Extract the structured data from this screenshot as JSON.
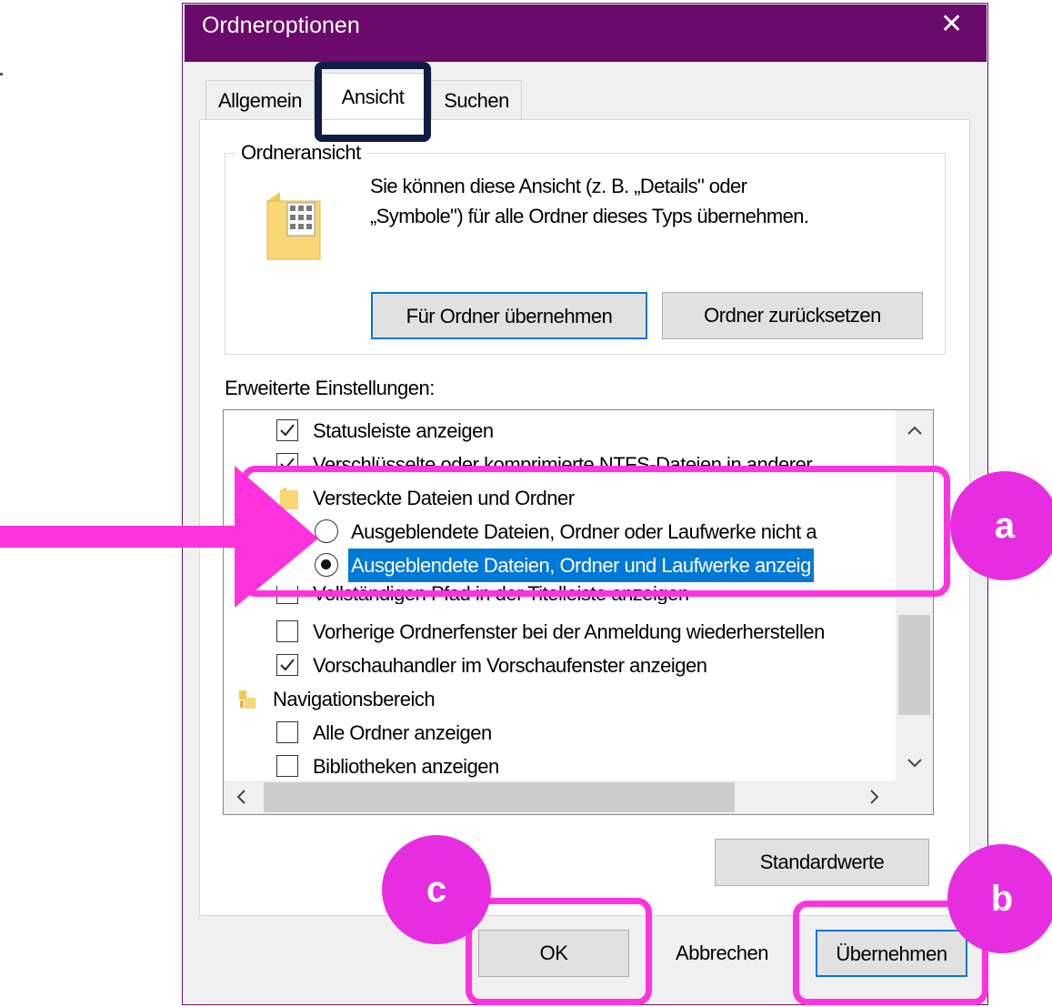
{
  "window": {
    "title": "Ordneroptionen",
    "close_glyph": "✕"
  },
  "tabs": [
    {
      "label": "Allgemein",
      "active": false
    },
    {
      "label": "Ansicht",
      "active": true
    },
    {
      "label": "Suchen",
      "active": false
    }
  ],
  "folder_view": {
    "group_title": "Ordneransicht",
    "description_line1": "Sie können diese Ansicht (z. B. „Details\" oder",
    "description_line2": "„Symbole\") für alle Ordner dieses Typs übernehmen.",
    "apply_button": "Für Ordner übernehmen",
    "reset_button": "Ordner zurücksetzen",
    "icon": "folder-grid-icon"
  },
  "advanced": {
    "label": "Erweiterte Einstellungen:",
    "items": [
      {
        "type": "checkbox",
        "checked": true,
        "label": "Statusleiste anzeigen"
      },
      {
        "type": "checkbox",
        "checked": true,
        "label": "Verschlüsselte oder komprimierte NTFS-Dateien in anderer"
      },
      {
        "type": "folder",
        "label": "Versteckte Dateien und Ordner"
      },
      {
        "type": "radio",
        "checked": false,
        "label": "Ausgeblendete Dateien, Ordner oder Laufwerke nicht a"
      },
      {
        "type": "radio",
        "checked": true,
        "selected": true,
        "label": "Ausgeblendete Dateien, Ordner und Laufwerke anzeig"
      },
      {
        "type": "checkbox",
        "checked": true,
        "label": "Vollständigen Pfad in der Titelleiste anzeigen"
      },
      {
        "type": "checkbox",
        "checked": false,
        "label": "Vorherige Ordnerfenster bei der Anmeldung wiederherstellen"
      },
      {
        "type": "checkbox",
        "checked": true,
        "label": "Vorschauhandler im Vorschaufenster anzeigen"
      },
      {
        "type": "folder",
        "label": "Navigationsbereich"
      },
      {
        "type": "checkbox",
        "checked": false,
        "label": "Alle Ordner anzeigen"
      },
      {
        "type": "checkbox",
        "checked": false,
        "label": "Bibliotheken anzeigen"
      }
    ]
  },
  "buttons": {
    "defaults": "Standardwerte",
    "ok": "OK",
    "cancel": "Abbrechen",
    "apply": "Übernehmen"
  },
  "annotations": {
    "a": "a",
    "b": "b",
    "c": "c"
  },
  "colors": {
    "titlebar": "#6a0a6a",
    "highlight": "#ff33dd",
    "selection": "#0078d7",
    "tab_marker": "#0f1d45"
  }
}
